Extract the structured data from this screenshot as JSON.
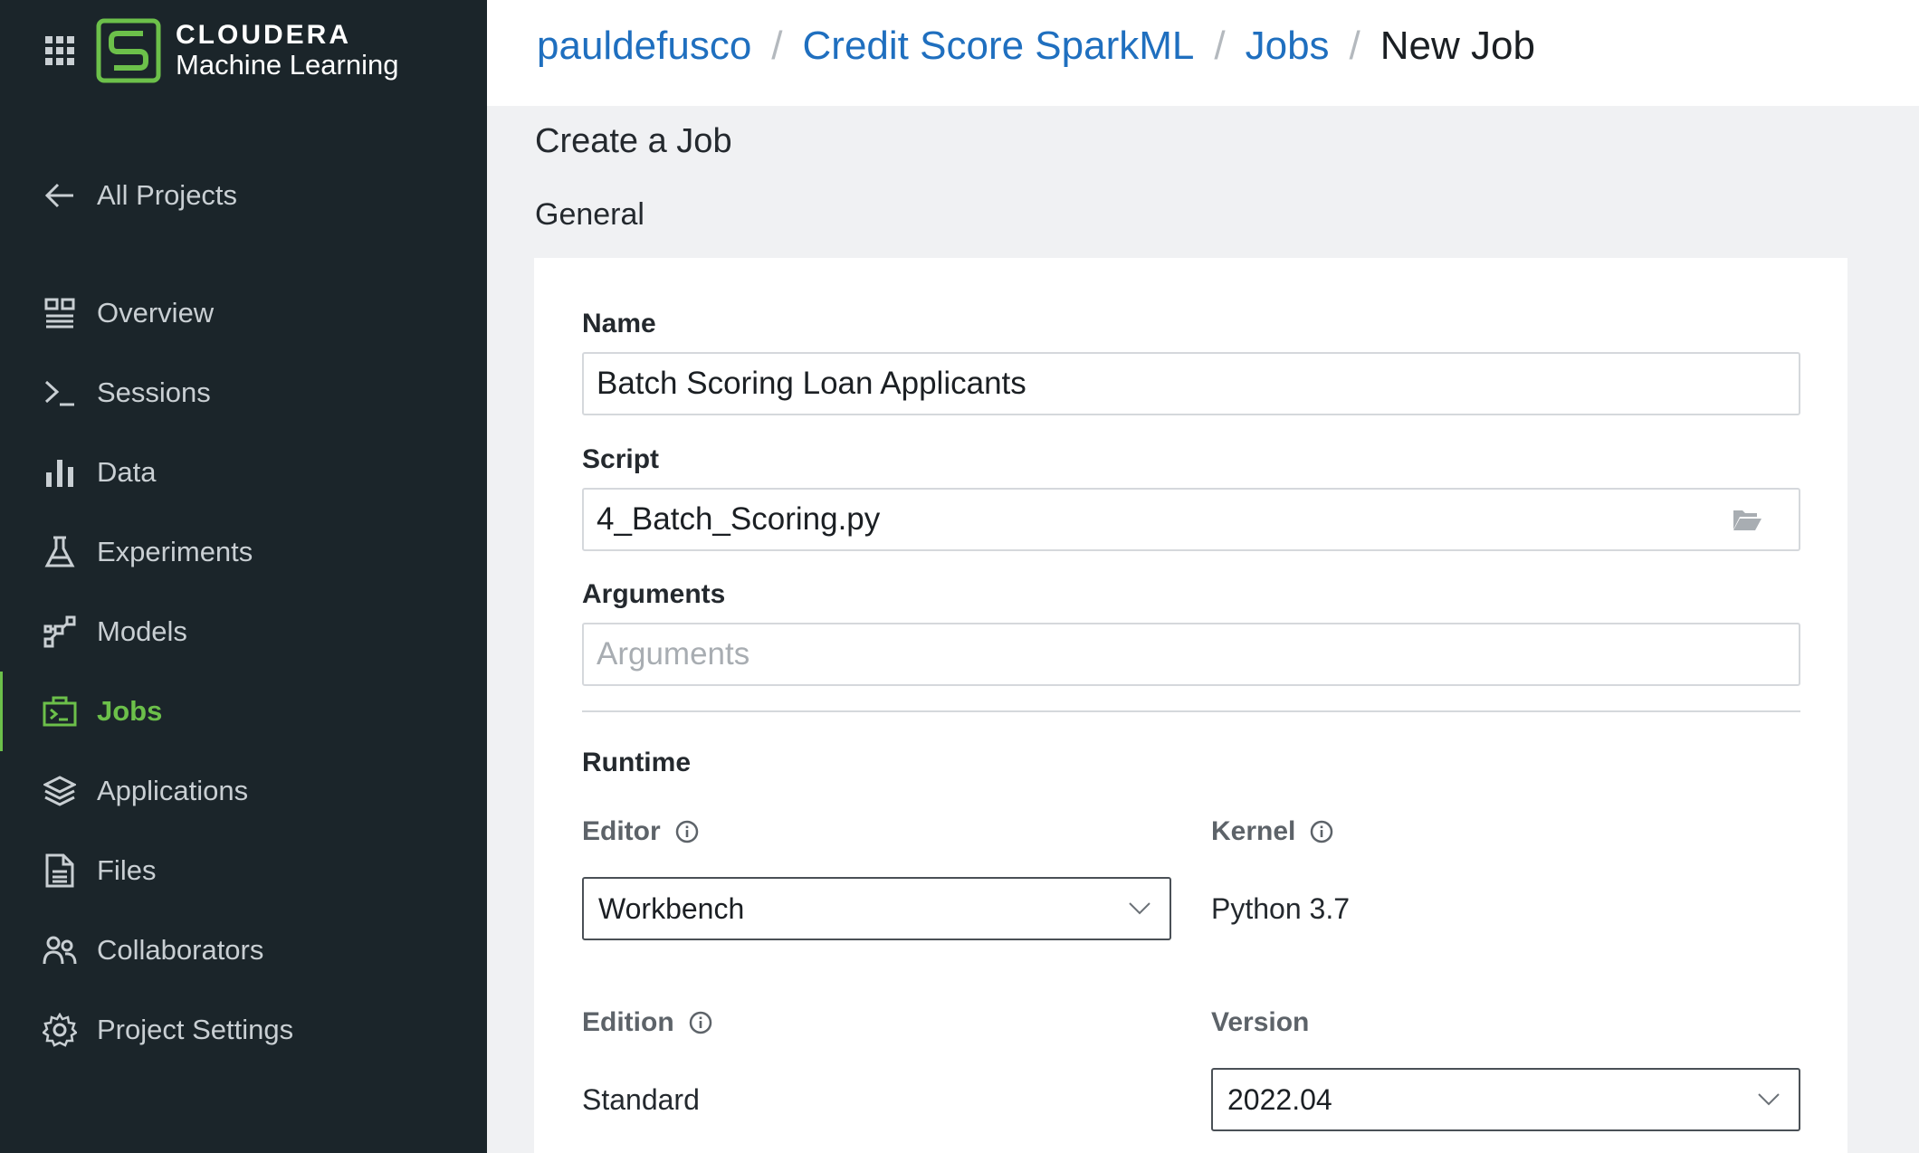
{
  "brand": {
    "name": "CLOUDERA",
    "product": "Machine Learning"
  },
  "nav": {
    "back_label": "All Projects",
    "items": [
      {
        "label": "Overview",
        "icon": "overview-icon"
      },
      {
        "label": "Sessions",
        "icon": "terminal-icon"
      },
      {
        "label": "Data",
        "icon": "bar-chart-icon"
      },
      {
        "label": "Experiments",
        "icon": "flask-icon"
      },
      {
        "label": "Models",
        "icon": "model-graph-icon"
      },
      {
        "label": "Jobs",
        "icon": "jobs-icon",
        "active": true
      },
      {
        "label": "Applications",
        "icon": "layers-icon"
      },
      {
        "label": "Files",
        "icon": "file-icon"
      },
      {
        "label": "Collaborators",
        "icon": "users-icon"
      },
      {
        "label": "Project Settings",
        "icon": "gear-icon"
      }
    ]
  },
  "breadcrumb": [
    "pauldefusco",
    "Credit Score SparkML",
    "Jobs",
    "New Job"
  ],
  "page": {
    "title": "Create a Job",
    "section": "General"
  },
  "form": {
    "name_label": "Name",
    "name_value": "Batch Scoring Loan Applicants",
    "script_label": "Script",
    "script_value": "4_Batch_Scoring.py",
    "arguments_label": "Arguments",
    "arguments_placeholder": "Arguments",
    "runtime_label": "Runtime",
    "editor_label": "Editor",
    "editor_value": "Workbench",
    "kernel_label": "Kernel",
    "kernel_value": "Python 3.7",
    "edition_label": "Edition",
    "edition_value": "Standard",
    "version_label": "Version",
    "version_value": "2022.04"
  },
  "colors": {
    "sidebar": "#1b252a",
    "accent": "#6cc04a",
    "link": "#1f6fbf"
  }
}
